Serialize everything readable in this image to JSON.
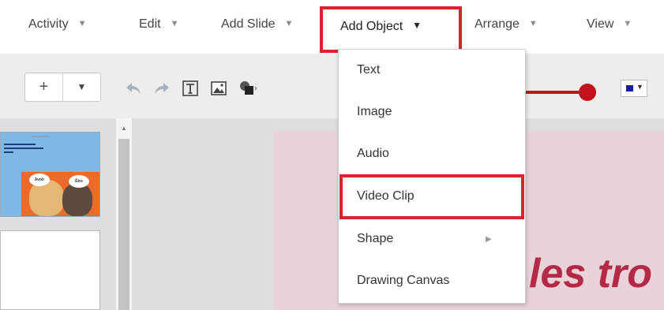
{
  "menubar": {
    "items": [
      {
        "label": "Activity"
      },
      {
        "label": "Edit"
      },
      {
        "label": "Add Slide"
      },
      {
        "label": "Add Object"
      },
      {
        "label": "Arrange"
      },
      {
        "label": "View"
      }
    ],
    "caret": "▼"
  },
  "toolbar": {
    "add_label": "+",
    "add_dropdown": "▼",
    "color_dropdown": "▼",
    "icons": [
      "undo-icon",
      "redo-icon",
      "text-box-icon",
      "image-icon",
      "shape-icon"
    ]
  },
  "thumbnail": {
    "bubble_left": "Avoir",
    "bubble_right": "Être"
  },
  "canvas": {
    "text": "les tro"
  },
  "dropdown": {
    "items": [
      {
        "label": "Text"
      },
      {
        "label": "Image"
      },
      {
        "label": "Audio"
      },
      {
        "label": "Video Clip"
      },
      {
        "label": "Shape",
        "submenu": "▶"
      },
      {
        "label": "Drawing Canvas"
      }
    ]
  },
  "colors": {
    "highlight_red": "#d9232d",
    "slider_red": "#c4121c",
    "color_swatch": "#1a1aa8",
    "slide_background": "#ead2da",
    "slide_text": "#b42a45"
  }
}
